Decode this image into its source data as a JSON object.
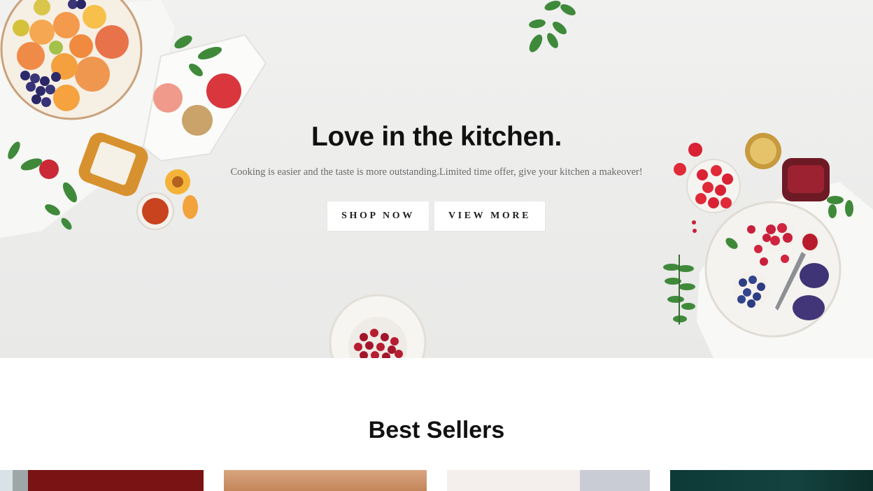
{
  "hero": {
    "title": "Love in the kitchen.",
    "subtitle": "Cooking is easier and the taste is more outstanding.Limited time offer, give your kitchen a makeover!",
    "shop_label": "SHOP NOW",
    "view_label": "VIEW MORE"
  },
  "best_sellers": {
    "title": "Best Sellers",
    "products": [
      {
        "name": "product-card-1"
      },
      {
        "name": "product-card-2"
      },
      {
        "name": "product-card-3"
      },
      {
        "name": "product-card-4"
      }
    ]
  },
  "colors": {
    "hero_bg": "#eeeeed",
    "text_dark": "#111111",
    "subtitle": "#6b6b6b",
    "button_bg": "#ffffff"
  }
}
